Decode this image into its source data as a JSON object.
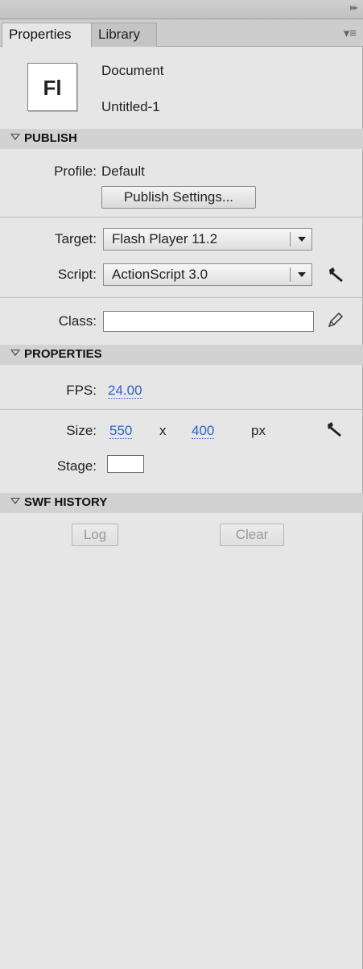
{
  "tabs": {
    "properties": "Properties",
    "library": "Library"
  },
  "document": {
    "icon_text": "Fl",
    "type_label": "Document",
    "name": "Untitled-1"
  },
  "publish": {
    "header": "PUBLISH",
    "profile_label": "Profile:",
    "profile_value": "Default",
    "publish_settings_button": "Publish Settings...",
    "target_label": "Target:",
    "target_value": "Flash Player 11.2",
    "script_label": "Script:",
    "script_value": "ActionScript 3.0",
    "class_label": "Class:",
    "class_value": ""
  },
  "properties": {
    "header": "PROPERTIES",
    "fps_label": "FPS:",
    "fps_value": "24.00",
    "size_label": "Size:",
    "width": "550",
    "x_sep": "x",
    "height": "400",
    "unit": "px",
    "stage_label": "Stage:",
    "stage_color": "#ffffff"
  },
  "swf_history": {
    "header": "SWF HISTORY",
    "log_button": "Log",
    "clear_button": "Clear"
  },
  "icons": [
    "panel-menu-icon",
    "collapse-triangle-icon",
    "wrench-icon",
    "pencil-icon",
    "dropdown-arrow-icon"
  ]
}
